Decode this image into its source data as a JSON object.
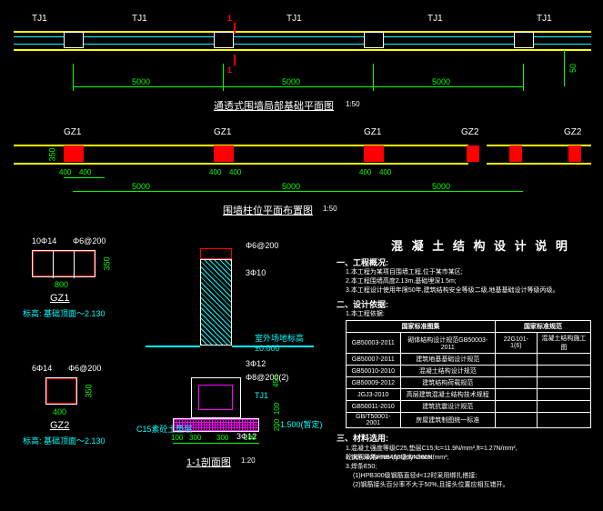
{
  "plan1": {
    "title": "通透式围墙局部基础平面图",
    "scale": "1:50",
    "dims": [
      "5000",
      "5000",
      "5000"
    ],
    "labels": [
      "TJ1",
      "TJ1",
      "1",
      "TJ1",
      "TJ1",
      "TJ1"
    ],
    "side_dim": "50"
  },
  "plan2": {
    "title": "围墙柱位平面布置图",
    "scale": "1:50",
    "col_labels": [
      "GZ1",
      "GZ1",
      "GZ1",
      "GZ2",
      "GZ2"
    ],
    "dims_h": [
      "5000",
      "5000",
      "5000"
    ],
    "dims_v": "350",
    "dims_small": [
      "400",
      "400",
      "400",
      "400",
      "400",
      "400",
      "400",
      "400"
    ]
  },
  "details": {
    "gz1": {
      "name": "GZ1",
      "rebar1": "10Φ14",
      "rebar2": "Φ6@200",
      "w": "800",
      "h": "350",
      "elev": "标高: 基础顶面～2.130"
    },
    "gz2": {
      "name": "GZ2",
      "rebar1": "6Φ14",
      "rebar2": "Φ6@200",
      "w": "400",
      "h": "350",
      "elev": "标高: 基础顶面～2.130"
    },
    "section": {
      "name": "1-1剖面图",
      "scale": "1:20",
      "notes": [
        "Φ6@200",
        "3Φ10",
        "3Φ12",
        "Φ8@200(2)",
        "TJ1",
        "3Φ12",
        "C15素砼土垫层"
      ],
      "dims": [
        "300",
        "100",
        "100",
        "300",
        "450",
        "100",
        "200",
        "-1.500(暂定)",
        "室外场地标高±0.000"
      ]
    }
  },
  "notes": {
    "title": "混 凝 土 结 构 设 计 说 明",
    "s1": "一、工程概况:",
    "s1_items": [
      "1.本工程为某项目围墙工程,位于某市某区;",
      "2.本工程围墙高度2.13m,基础埋深1.5m;",
      "3.本工程设计使用年限50年,建筑结构安全等级二级,地基基础设计等级丙级。"
    ],
    "s2": "二、设计依据:",
    "s2_items": [
      "1.本工程依据:"
    ],
    "s3": "三、材料选用:",
    "s3_items": [
      "1.混凝土强度等级C25,垫层C15;fc=11.9N/mm²,ft=1.27N/mm²,砼:fc=360N/mm²,fy=360N/mm²;",
      "2.钢筋采用HRB400级,fy=360N/mm²;",
      "3.焊条E50;",
      "(1)HPB300级钢筋直径d<12时采用绑扎搭接;",
      "(2)钢筋接头百分率不大于50%,且接头位置应相互错开。"
    ],
    "table": {
      "headers": [
        "国家标准图集",
        "国家标准规范"
      ],
      "rows": [
        [
          "GB50003-2011",
          "砌体结构设计规范GB50003-2011",
          "",
          ""
        ],
        [
          "GB50007-2011",
          "建筑地基基础设计规范",
          "22G101-1(6)",
          "混凝土结构施工图"
        ],
        [
          "GB50010-2010",
          "混凝土结构设计规范",
          "",
          ""
        ],
        [
          "GB50009-2012",
          "建筑结构荷载规范",
          "",
          ""
        ],
        [
          "JGJ3-2010",
          "高层建筑混凝土结构技术规程",
          "",
          ""
        ],
        [
          "GB50011-2010",
          "建筑抗震设计规范",
          "",
          ""
        ],
        [
          "GB/T50001-2001",
          "房屋建筑制图统一标准",
          "",
          ""
        ]
      ]
    }
  }
}
